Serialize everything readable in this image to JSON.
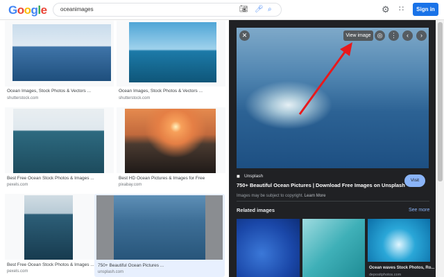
{
  "header": {
    "logo": "Google",
    "query": "oceanimages",
    "signin": "Sign in"
  },
  "results": [
    {
      "caption": "Ocean Images, Stock Photos & Vectors ...",
      "source": "shutterstock.com"
    },
    {
      "caption": "Ocean Images, Stock Photos & Vectors ...",
      "source": "shutterstock.com"
    },
    {
      "caption": "Best Free Ocean Stock Photos & Images ...",
      "source": "pexels.com"
    },
    {
      "caption": "Best HD Ocean Pictures & Images for Free",
      "source": "pixabay.com"
    },
    {
      "caption": "Best Free Ocean Stock Photos & Images ...",
      "source": "pexels.com"
    },
    {
      "caption": "750+ Beautiful Ocean Pictures ...",
      "source": "unsplash.com"
    }
  ],
  "preview": {
    "view_image": "View image",
    "site": "Unsplash",
    "title": "750+ Beautiful Ocean Pictures | Download Free Images on Unsplash",
    "copyright": "Images may be subject to copyright.",
    "learn_more": "Learn More",
    "visit": "Visit",
    "related_heading": "Related images",
    "see_more": "See more",
    "related": [
      {
        "caption": ""
      },
      {
        "caption": ""
      },
      {
        "caption": "Ocean waves Stock Photos, Ro...",
        "source": "depositphotos.com"
      }
    ]
  },
  "colors": {
    "accent": "#1a73e8",
    "panel_bg": "#202124",
    "arrow": "#e8191c",
    "visit_bg": "#8ab4f8"
  }
}
